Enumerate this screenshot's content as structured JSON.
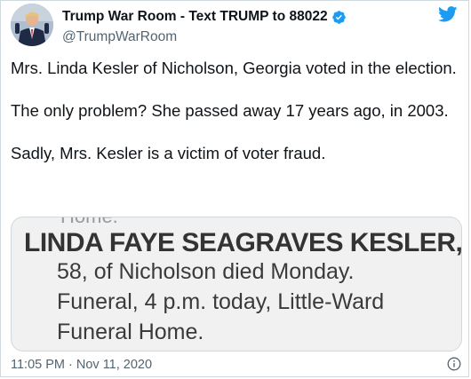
{
  "tweet": {
    "display_name": "Trump War Room - Text TRUMP to 88022",
    "handle": "@TrumpWarRoom",
    "paragraphs": [
      "Mrs. Linda Kesler of Nicholson, Georgia voted in the election.",
      "The only problem? She passed away 17 years ago, in 2003.",
      "Sadly, Mrs. Kesler is a victim of voter fraud."
    ],
    "timestamp": "11:05 PM · Nov 11, 2020"
  },
  "media": {
    "clipped_text": "Home.",
    "obituary_name": "LINDA FAYE SEAGRAVES KESLER,",
    "obituary_lines": [
      "58, of Nicholson died Monday.",
      "Funeral, 4 p.m. today, Little-Ward",
      "Funeral Home."
    ]
  },
  "icons": {
    "verified": "verified-badge-icon",
    "logo": "twitter-bird-icon",
    "info": "info-icon"
  },
  "colors": {
    "accent": "#1d9bf0",
    "text": "#0f1419",
    "secondary_text": "#536471",
    "border": "#cfd9de"
  }
}
